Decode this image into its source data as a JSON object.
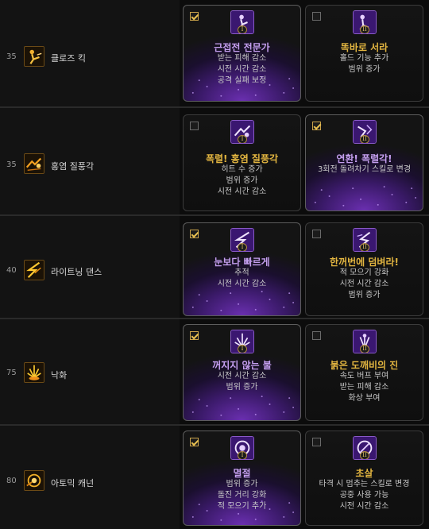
{
  "rows": [
    {
      "level": "35",
      "skill_name": "클로즈 킥",
      "skill_icon": "kick-icon",
      "options": [
        {
          "checked": true,
          "numeral": "I",
          "title": "근접전 전문가",
          "desc": [
            "받는 피해 감소",
            "시전 시간 감소",
            "공격 실패 보정"
          ]
        },
        {
          "checked": false,
          "numeral": "II",
          "title": "똑바로 서라",
          "desc": [
            "홀드 기능 추가",
            "범위 증가"
          ]
        }
      ]
    },
    {
      "level": "35",
      "skill_name": "홍염 질풍각",
      "skill_icon": "flame-kick-icon",
      "options": [
        {
          "checked": false,
          "numeral": "I",
          "title": "폭렬! 홍염 질풍각",
          "desc": [
            "히트 수 증가",
            "범위 증가",
            "시전 시간 감소"
          ]
        },
        {
          "checked": true,
          "numeral": "II",
          "title": "연환! 폭렬각!",
          "desc": [
            "3회전 돌려차기 스킬로 변경"
          ]
        }
      ]
    },
    {
      "level": "40",
      "skill_name": "라이트닝 댄스",
      "skill_icon": "lightning-icon",
      "options": [
        {
          "checked": true,
          "numeral": "I",
          "title": "눈보다 빠르게",
          "desc": [
            "추적",
            "시전 시간 감소"
          ]
        },
        {
          "checked": false,
          "numeral": "II",
          "title": "한꺼번에 덤벼라!",
          "desc": [
            "적 모으기 강화",
            "시전 시간 감소",
            "범위 증가"
          ]
        }
      ]
    },
    {
      "level": "75",
      "skill_name": "낙화",
      "skill_icon": "falling-flower-icon",
      "options": [
        {
          "checked": true,
          "numeral": "I",
          "title": "꺼지지 않는 불",
          "desc": [
            "시전 시간 감소",
            "범위 증가"
          ]
        },
        {
          "checked": false,
          "numeral": "II",
          "title": "붉은 도깨비의 진",
          "desc": [
            "속도 버프 부여",
            "받는 피해 감소",
            "화상 부여"
          ]
        }
      ]
    },
    {
      "level": "80",
      "skill_name": "아토믹 캐넌",
      "skill_icon": "atomic-cannon-icon",
      "options": [
        {
          "checked": true,
          "numeral": "I",
          "title": "멸절",
          "desc": [
            "범위 증가",
            "돌진 거리 강화",
            "적 모으기 추가"
          ]
        },
        {
          "checked": false,
          "numeral": "II",
          "title": "초살",
          "desc": [
            "타격 시 멈추는 스킬로 변경",
            "공중 사용 가능",
            "시전 시간 감소"
          ]
        }
      ]
    }
  ]
}
